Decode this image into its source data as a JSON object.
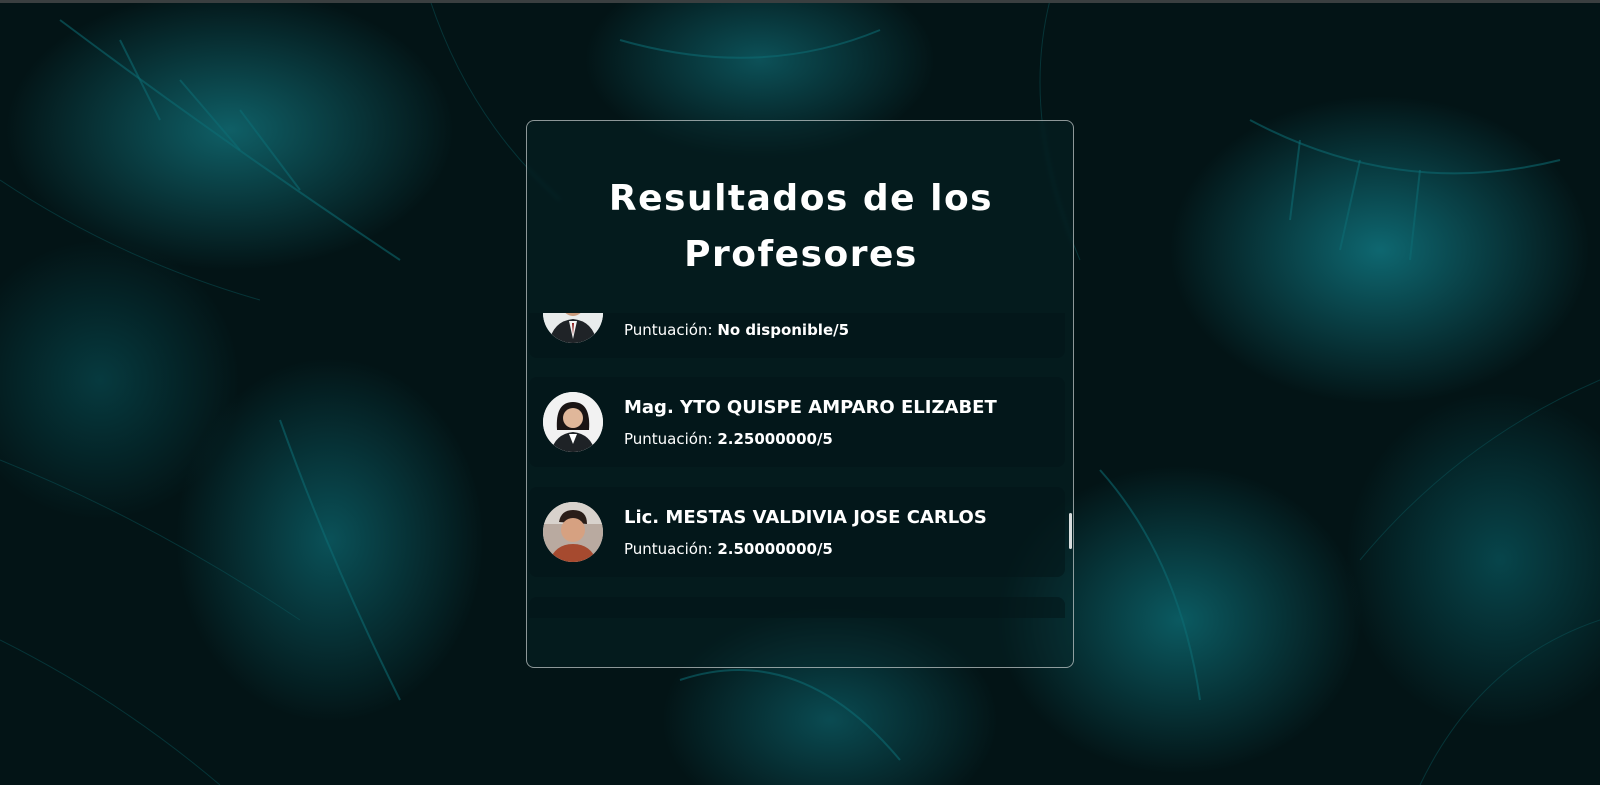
{
  "page": {
    "title_line1": "Resultados de los",
    "title_line2": "Profesores"
  },
  "colors": {
    "accent_teal": "#0e6770",
    "card_border": "#ffffff",
    "text": "#ffffff"
  },
  "professors": [
    {
      "name": "",
      "score_label": "Puntuación:",
      "score_value": "No disponible/5",
      "avatar": "avatar-man-suit"
    },
    {
      "name": "Mag. YTO QUISPE AMPARO ELIZABET",
      "score_label": "Puntuación:",
      "score_value": "2.25000000/5",
      "avatar": "avatar-woman"
    },
    {
      "name": "Lic. MESTAS VALDIVIA JOSE CARLOS",
      "score_label": "Puntuación:",
      "score_value": "2.50000000/5",
      "avatar": "avatar-man"
    }
  ]
}
